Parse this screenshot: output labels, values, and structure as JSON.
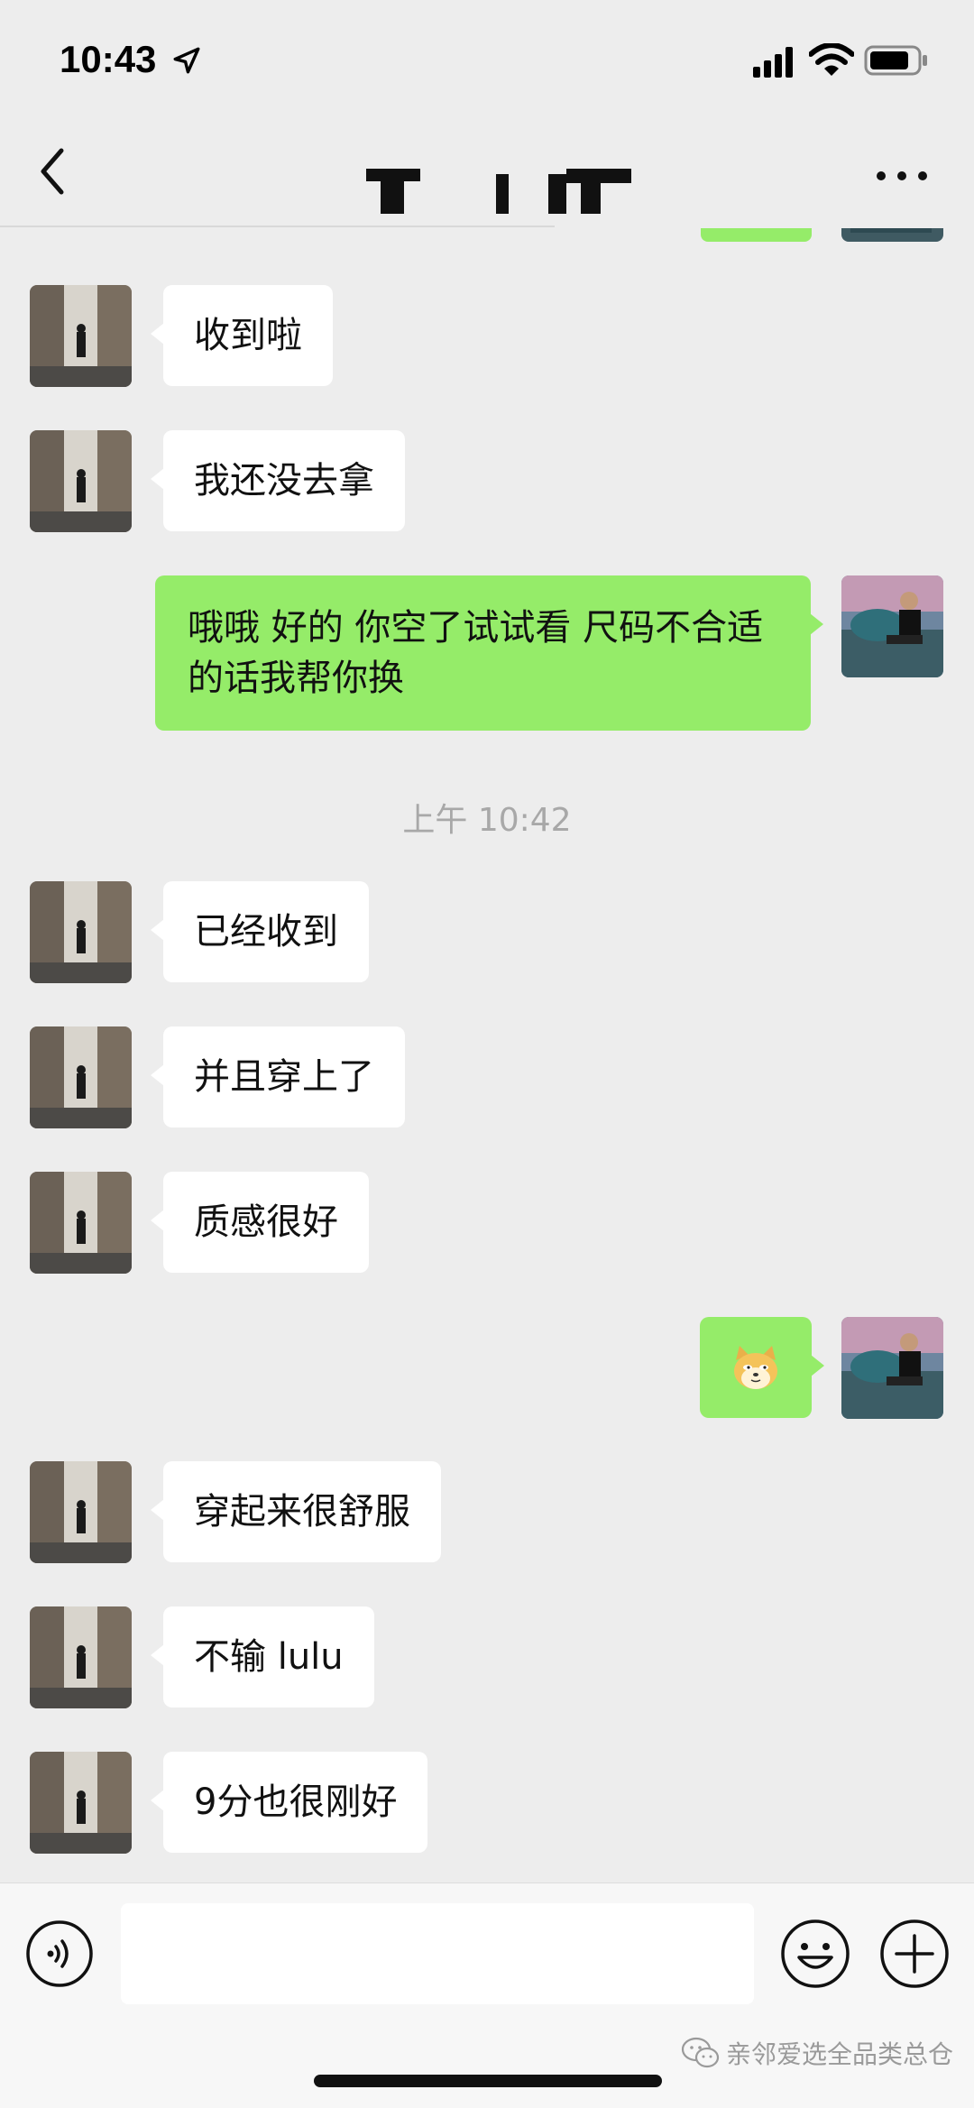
{
  "status_bar": {
    "time": "10:43"
  },
  "header": {
    "title": ""
  },
  "messages": [
    {
      "side": "in",
      "text": "收到啦"
    },
    {
      "side": "in",
      "text": "我还没去拿"
    },
    {
      "side": "out",
      "text": "哦哦 好的 你空了试试看 尺码不合适的话我帮你换"
    },
    {
      "side": "in",
      "text": "已经收到"
    },
    {
      "side": "in",
      "text": "并且穿上了"
    },
    {
      "side": "in",
      "text": "质感很好"
    },
    {
      "side": "out",
      "text": "",
      "sticker": "doge-emoji"
    },
    {
      "side": "in",
      "text": "穿起来很舒服"
    },
    {
      "side": "in",
      "text": "不输 lulu"
    },
    {
      "side": "in",
      "text": "9分也很刚好"
    }
  ],
  "timestamp": "上午 10:42",
  "input": {
    "value": "",
    "placeholder": ""
  },
  "watermark": "亲邻爱选全品类总仓",
  "colors": {
    "outgoing_bubble": "#95ec69",
    "incoming_bubble": "#ffffff",
    "background": "#ededed"
  },
  "icons": [
    "location-arrow-icon",
    "signal-icon",
    "wifi-icon",
    "battery-icon",
    "back-chevron-icon",
    "more-dots-icon",
    "voice-icon",
    "emoji-icon",
    "plus-icon",
    "wechat-icon"
  ]
}
